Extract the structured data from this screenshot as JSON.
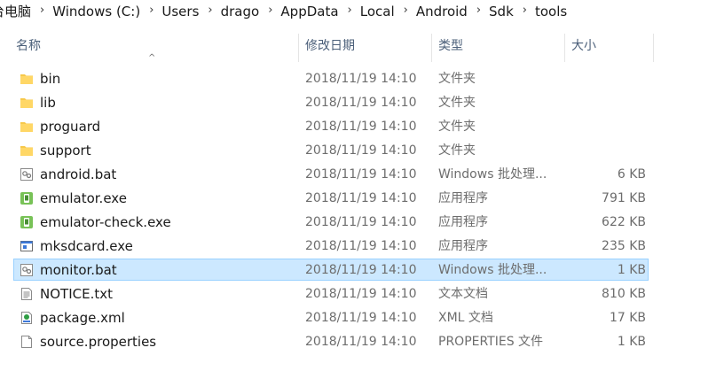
{
  "breadcrumb": [
    "台电脑",
    "Windows (C:)",
    "Users",
    "drago",
    "AppData",
    "Local",
    "Android",
    "Sdk",
    "tools"
  ],
  "columns": {
    "name": "名称",
    "date": "修改日期",
    "type": "类型",
    "size": "大小"
  },
  "files": [
    {
      "name": "bin",
      "date": "2018/11/19 14:10",
      "type": "文件夹",
      "size": "",
      "icon": "folder-icon"
    },
    {
      "name": "lib",
      "date": "2018/11/19 14:10",
      "type": "文件夹",
      "size": "",
      "icon": "folder-icon"
    },
    {
      "name": "proguard",
      "date": "2018/11/19 14:10",
      "type": "文件夹",
      "size": "",
      "icon": "folder-icon"
    },
    {
      "name": "support",
      "date": "2018/11/19 14:10",
      "type": "文件夹",
      "size": "",
      "icon": "folder-icon"
    },
    {
      "name": "android.bat",
      "date": "2018/11/19 14:10",
      "type": "Windows 批处理...",
      "size": "6 KB",
      "icon": "batch-file-icon"
    },
    {
      "name": "emulator.exe",
      "date": "2018/11/19 14:10",
      "type": "应用程序",
      "size": "791 KB",
      "icon": "android-exe-icon"
    },
    {
      "name": "emulator-check.exe",
      "date": "2018/11/19 14:10",
      "type": "应用程序",
      "size": "622 KB",
      "icon": "android-exe-icon"
    },
    {
      "name": "mksdcard.exe",
      "date": "2018/11/19 14:10",
      "type": "应用程序",
      "size": "235 KB",
      "icon": "application-icon"
    },
    {
      "name": "monitor.bat",
      "date": "2018/11/19 14:10",
      "type": "Windows 批处理...",
      "size": "1 KB",
      "icon": "batch-file-icon",
      "selected": true
    },
    {
      "name": "NOTICE.txt",
      "date": "2018/11/19 14:10",
      "type": "文本文档",
      "size": "810 KB",
      "icon": "text-file-icon"
    },
    {
      "name": "package.xml",
      "date": "2018/11/19 14:10",
      "type": "XML 文档",
      "size": "17 KB",
      "icon": "xml-file-icon"
    },
    {
      "name": "source.properties",
      "date": "2018/11/19 14:10",
      "type": "PROPERTIES 文件",
      "size": "1 KB",
      "icon": "blank-file-icon"
    }
  ],
  "colors": {
    "selection_bg": "#cce8ff",
    "selection_border": "#99d1ff",
    "header_text": "#4c607a",
    "folder": "#f7c84a"
  }
}
